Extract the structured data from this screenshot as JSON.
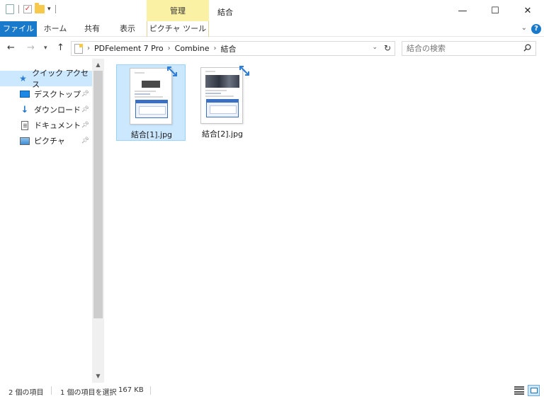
{
  "window": {
    "title": "結合",
    "context_tab_group": "管理",
    "controls": {
      "minimize": "—",
      "maximize": "☐",
      "close": "✕"
    }
  },
  "ribbon": {
    "tabs": [
      {
        "label": "ファイル",
        "active": true
      },
      {
        "label": "ホーム"
      },
      {
        "label": "共有"
      },
      {
        "label": "表示"
      },
      {
        "label": "ピクチャ ツール"
      }
    ],
    "expand_icon": "chevron-down-icon",
    "help_icon": "?"
  },
  "navigation": {
    "back": "←",
    "forward": "→",
    "recent": "⌄",
    "up": "↑",
    "breadcrumb": [
      "PDFelement 7 Pro",
      "Combine",
      "結合"
    ],
    "search_placeholder": "結合の検索"
  },
  "nav_pane": {
    "items": [
      {
        "label": "クイック アクセス",
        "icon": "star-icon",
        "selected": true
      },
      {
        "label": "デスクトップ",
        "icon": "desktop-icon",
        "pinned": true
      },
      {
        "label": "ダウンロード",
        "icon": "download-icon",
        "pinned": true
      },
      {
        "label": "ドキュメント",
        "icon": "documents-icon",
        "pinned": true
      },
      {
        "label": "ピクチャ",
        "icon": "pictures-icon",
        "pinned": true
      }
    ]
  },
  "files": [
    {
      "name": "結合[1].jpg",
      "selected": true
    },
    {
      "name": "結合[2].jpg",
      "selected": false
    }
  ],
  "status": {
    "item_count": "2 個の項目",
    "selected": "1 個の項目を選択",
    "size": "167 KB"
  },
  "colors": {
    "accent": "#1979ca",
    "selection": "#cce8ff",
    "manage_tab": "#fbf1a5"
  }
}
